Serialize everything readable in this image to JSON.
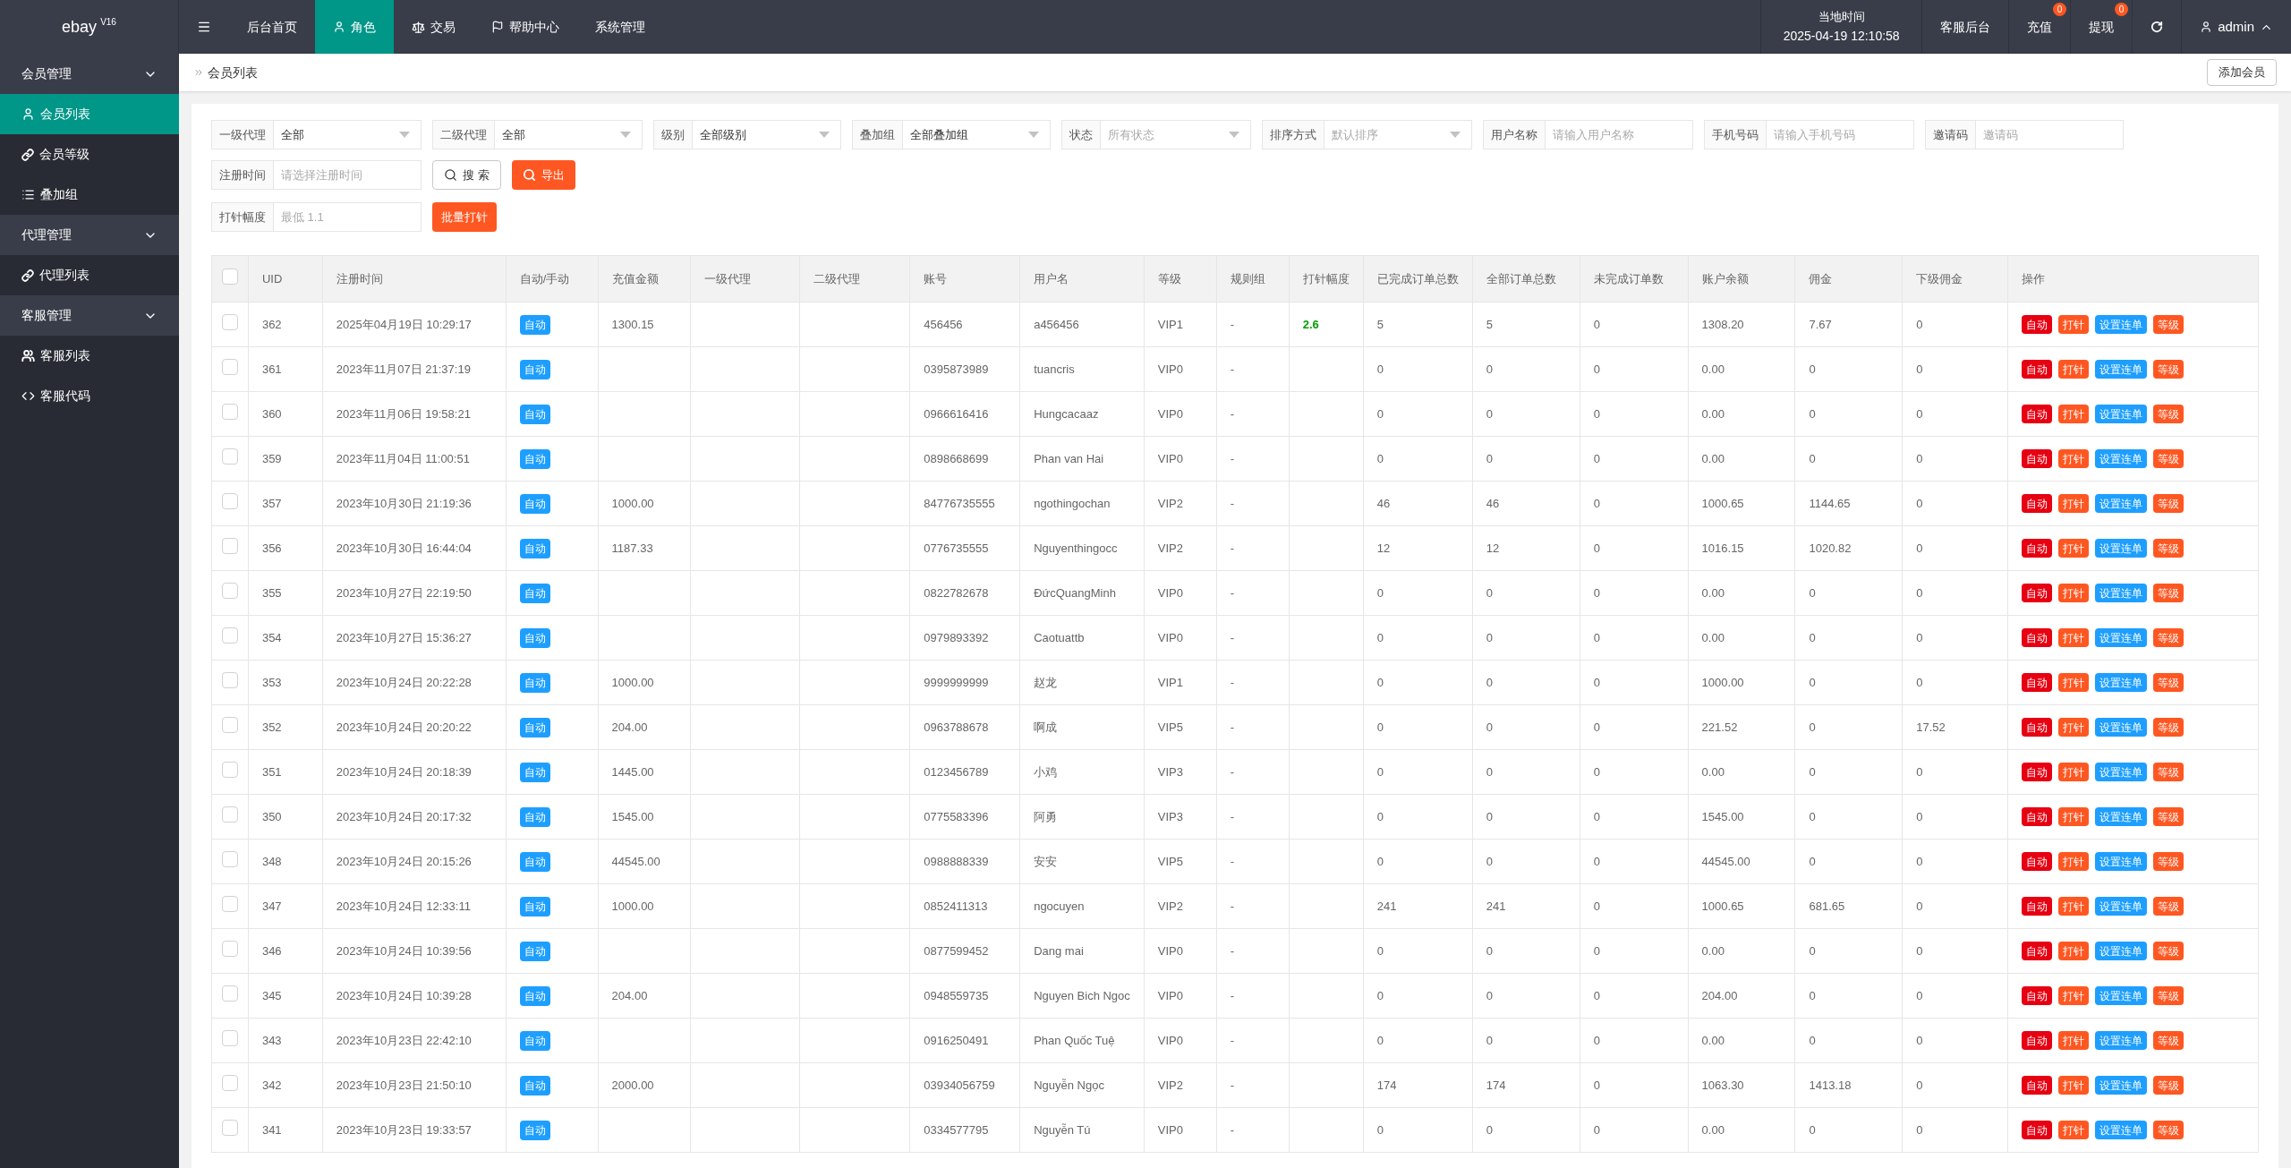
{
  "logo": {
    "name": "ebay",
    "version": "V16"
  },
  "nav": [
    {
      "label": "后台首页",
      "selected": false
    },
    {
      "label": "角色",
      "selected": true
    },
    {
      "label": "交易",
      "selected": false
    },
    {
      "label": "帮助中心",
      "selected": false
    },
    {
      "label": "系统管理",
      "selected": false
    }
  ],
  "header_right": {
    "time_label": "当地时间",
    "time": "2025-04-19 12:10:58",
    "support": "客服后台",
    "recharge": {
      "label": "充值",
      "count": "0"
    },
    "withdraw": {
      "label": "提现",
      "count": "0"
    },
    "user": "admin"
  },
  "sidebar": [
    {
      "label": "会员管理",
      "expanded": true,
      "children": [
        {
          "label": "会员列表",
          "selected": true
        },
        {
          "label": "会员等级",
          "selected": false
        },
        {
          "label": "叠加组",
          "selected": false
        }
      ]
    },
    {
      "label": "代理管理",
      "expanded": true,
      "children": [
        {
          "label": "代理列表",
          "selected": false
        }
      ]
    },
    {
      "label": "客服管理",
      "expanded": true,
      "children": [
        {
          "label": "客服列表",
          "selected": false
        },
        {
          "label": "客服代码",
          "selected": false
        }
      ]
    }
  ],
  "breadcrumb": "会员列表",
  "add_button": "添加会员",
  "filters": [
    {
      "kind": "select",
      "label": "一级代理",
      "value": "全部"
    },
    {
      "kind": "select",
      "label": "二级代理",
      "value": "全部"
    },
    {
      "kind": "select",
      "label": "级别",
      "value": "全部级别"
    },
    {
      "kind": "select",
      "label": "叠加组",
      "value": "全部叠加组"
    },
    {
      "kind": "select",
      "label": "状态",
      "placeholder": "所有状态"
    },
    {
      "kind": "select",
      "label": "排序方式",
      "placeholder": "默认排序"
    },
    {
      "kind": "input",
      "label": "用户名称",
      "placeholder": "请输入用户名称"
    },
    {
      "kind": "input",
      "label": "手机号码",
      "placeholder": "请输入手机号码"
    },
    {
      "kind": "input",
      "label": "邀请码",
      "placeholder": "邀请码"
    }
  ],
  "date_filter": {
    "label": "注册时间",
    "placeholder": "请选择注册时间"
  },
  "search_button": "搜 索",
  "export_button": "导出",
  "inject_filter": {
    "label": "打针幅度",
    "placeholder": "最低 1.1"
  },
  "batch_button": "批量打针",
  "table": {
    "header_checked": false,
    "columns": [
      "UID",
      "注册时间",
      "自动/手动",
      "充值金额",
      "一级代理",
      "二级代理",
      "账号",
      "用户名",
      "等级",
      "规则组",
      "打针幅度",
      "已完成订单总数",
      "全部订单总数",
      "未完成订单数",
      "账户余额",
      "佣金",
      "下级佣金",
      "操作"
    ],
    "rows": [
      {
        "checked": false,
        "uid": "362",
        "time": "2025年04月19日 10:29:17",
        "mode": "自动",
        "recharge": "1300.15",
        "account": "456456",
        "username": "a456456",
        "level": "VIP1",
        "rule": "-",
        "inject": "2.6",
        "done": "5",
        "total": "5",
        "pending": "0",
        "balance": "1308.20",
        "commission": "7.67",
        "sub_commission": "0",
        "actions": [
          "自动",
          "打针",
          "设置连单",
          "等级"
        ]
      },
      {
        "checked": false,
        "uid": "361",
        "time": "2023年11月07日 21:37:19",
        "mode": "自动",
        "account": "0395873989",
        "username": "tuancris",
        "level": "VIP0",
        "rule": "-",
        "done": "0",
        "total": "0",
        "pending": "0",
        "balance": "0.00",
        "commission": "0",
        "sub_commission": "0",
        "actions": [
          "自动",
          "打针",
          "设置连单",
          "等级"
        ]
      },
      {
        "checked": false,
        "uid": "360",
        "time": "2023年11月06日 19:58:21",
        "mode": "自动",
        "account": "0966616416",
        "username": "Hungcacaaz",
        "level": "VIP0",
        "rule": "-",
        "done": "0",
        "total": "0",
        "pending": "0",
        "balance": "0.00",
        "commission": "0",
        "sub_commission": "0",
        "actions": [
          "自动",
          "打针",
          "设置连单",
          "等级"
        ]
      },
      {
        "checked": false,
        "uid": "359",
        "time": "2023年11月04日 11:00:51",
        "mode": "自动",
        "account": "0898668699",
        "username": "Phan van Hai",
        "level": "VIP0",
        "rule": "-",
        "done": "0",
        "total": "0",
        "pending": "0",
        "balance": "0.00",
        "commission": "0",
        "sub_commission": "0",
        "actions": [
          "自动",
          "打针",
          "设置连单",
          "等级"
        ]
      },
      {
        "checked": false,
        "uid": "357",
        "time": "2023年10月30日 21:19:36",
        "mode": "自动",
        "recharge": "1000.00",
        "account": "84776735555",
        "username": "ngothingochan",
        "level": "VIP2",
        "rule": "-",
        "done": "46",
        "total": "46",
        "pending": "0",
        "balance": "1000.65",
        "commission": "1144.65",
        "sub_commission": "0",
        "actions": [
          "自动",
          "打针",
          "设置连单",
          "等级"
        ]
      },
      {
        "checked": false,
        "uid": "356",
        "time": "2023年10月30日 16:44:04",
        "mode": "自动",
        "recharge": "1187.33",
        "account": "0776735555",
        "username": "Nguyenthingocc",
        "level": "VIP2",
        "rule": "-",
        "done": "12",
        "total": "12",
        "pending": "0",
        "balance": "1016.15",
        "commission": "1020.82",
        "sub_commission": "0",
        "actions": [
          "自动",
          "打针",
          "设置连单",
          "等级"
        ]
      },
      {
        "checked": false,
        "uid": "355",
        "time": "2023年10月27日 22:19:50",
        "mode": "自动",
        "account": "0822782678",
        "username": "ĐứcQuangMinh",
        "level": "VIP0",
        "rule": "-",
        "done": "0",
        "total": "0",
        "pending": "0",
        "balance": "0.00",
        "commission": "0",
        "sub_commission": "0",
        "actions": [
          "自动",
          "打针",
          "设置连单",
          "等级"
        ]
      },
      {
        "checked": false,
        "uid": "354",
        "time": "2023年10月27日 15:36:27",
        "mode": "自动",
        "account": "0979893392",
        "username": "Caotuattb",
        "level": "VIP0",
        "rule": "-",
        "done": "0",
        "total": "0",
        "pending": "0",
        "balance": "0.00",
        "commission": "0",
        "sub_commission": "0",
        "actions": [
          "自动",
          "打针",
          "设置连单",
          "等级"
        ]
      },
      {
        "checked": false,
        "uid": "353",
        "time": "2023年10月24日 20:22:28",
        "mode": "自动",
        "recharge": "1000.00",
        "account": "9999999999",
        "username": "赵龙",
        "level": "VIP1",
        "rule": "-",
        "done": "0",
        "total": "0",
        "pending": "0",
        "balance": "1000.00",
        "commission": "0",
        "sub_commission": "0",
        "actions": [
          "自动",
          "打针",
          "设置连单",
          "等级"
        ]
      },
      {
        "checked": false,
        "uid": "352",
        "time": "2023年10月24日 20:20:22",
        "mode": "自动",
        "recharge": "204.00",
        "account": "0963788678",
        "username": "啊成",
        "level": "VIP5",
        "rule": "-",
        "done": "0",
        "total": "0",
        "pending": "0",
        "balance": "221.52",
        "commission": "0",
        "sub_commission": "17.52",
        "actions": [
          "自动",
          "打针",
          "设置连单",
          "等级"
        ]
      },
      {
        "checked": false,
        "uid": "351",
        "time": "2023年10月24日 20:18:39",
        "mode": "自动",
        "recharge": "1445.00",
        "account": "0123456789",
        "username": "小鸡",
        "level": "VIP3",
        "rule": "-",
        "done": "0",
        "total": "0",
        "pending": "0",
        "balance": "0.00",
        "commission": "0",
        "sub_commission": "0",
        "actions": [
          "自动",
          "打针",
          "设置连单",
          "等级"
        ]
      },
      {
        "checked": false,
        "uid": "350",
        "time": "2023年10月24日 20:17:32",
        "mode": "自动",
        "recharge": "1545.00",
        "account": "0775583396",
        "username": "阿勇",
        "level": "VIP3",
        "rule": "-",
        "done": "0",
        "total": "0",
        "pending": "0",
        "balance": "1545.00",
        "commission": "0",
        "sub_commission": "0",
        "actions": [
          "自动",
          "打针",
          "设置连单",
          "等级"
        ]
      },
      {
        "checked": false,
        "uid": "348",
        "time": "2023年10月24日 20:15:26",
        "mode": "自动",
        "recharge": "44545.00",
        "account": "0988888339",
        "username": "安安",
        "level": "VIP5",
        "rule": "-",
        "done": "0",
        "total": "0",
        "pending": "0",
        "balance": "44545.00",
        "commission": "0",
        "sub_commission": "0",
        "actions": [
          "自动",
          "打针",
          "设置连单",
          "等级"
        ]
      },
      {
        "checked": false,
        "uid": "347",
        "time": "2023年10月24日 12:33:11",
        "mode": "自动",
        "recharge": "1000.00",
        "account": "0852411313",
        "username": "ngocuyen",
        "level": "VIP2",
        "rule": "-",
        "done": "241",
        "total": "241",
        "pending": "0",
        "balance": "1000.65",
        "commission": "681.65",
        "sub_commission": "0",
        "actions": [
          "自动",
          "打针",
          "设置连单",
          "等级"
        ]
      },
      {
        "checked": false,
        "uid": "346",
        "time": "2023年10月24日 10:39:56",
        "mode": "自动",
        "account": "0877599452",
        "username": "Dang mai",
        "level": "VIP0",
        "rule": "-",
        "done": "0",
        "total": "0",
        "pending": "0",
        "balance": "0.00",
        "commission": "0",
        "sub_commission": "0",
        "actions": [
          "自动",
          "打针",
          "设置连单",
          "等级"
        ]
      },
      {
        "checked": false,
        "uid": "345",
        "time": "2023年10月24日 10:39:28",
        "mode": "自动",
        "recharge": "204.00",
        "account": "0948559735",
        "username": "Nguyen Bich Ngoc",
        "level": "VIP0",
        "rule": "-",
        "done": "0",
        "total": "0",
        "pending": "0",
        "balance": "204.00",
        "commission": "0",
        "sub_commission": "0",
        "actions": [
          "自动",
          "打针",
          "设置连单",
          "等级"
        ]
      },
      {
        "checked": false,
        "uid": "343",
        "time": "2023年10月23日 22:42:10",
        "mode": "自动",
        "account": "0916250491",
        "username": "Phan Quốc Tuệ",
        "level": "VIP0",
        "rule": "-",
        "done": "0",
        "total": "0",
        "pending": "0",
        "balance": "0.00",
        "commission": "0",
        "sub_commission": "0",
        "actions": [
          "自动",
          "打针",
          "设置连单",
          "等级"
        ]
      },
      {
        "checked": false,
        "uid": "342",
        "time": "2023年10月23日 21:50:10",
        "mode": "自动",
        "recharge": "2000.00",
        "account": "03934056759",
        "username": "Nguyễn Ngọc",
        "level": "VIP2",
        "rule": "-",
        "done": "174",
        "total": "174",
        "pending": "0",
        "balance": "1063.30",
        "commission": "1413.18",
        "sub_commission": "0",
        "actions": [
          "自动",
          "打针",
          "设置连单",
          "等级"
        ]
      },
      {
        "checked": false,
        "uid": "341",
        "time": "2023年10月23日 19:33:57",
        "mode": "自动",
        "account": "0334577795",
        "username": "Nguyễn Tú",
        "level": "VIP0",
        "rule": "-",
        "done": "0",
        "total": "0",
        "pending": "0",
        "balance": "0.00",
        "commission": "0",
        "sub_commission": "0",
        "actions": [
          "自动",
          "打针",
          "设置连单",
          "等级"
        ]
      }
    ]
  }
}
